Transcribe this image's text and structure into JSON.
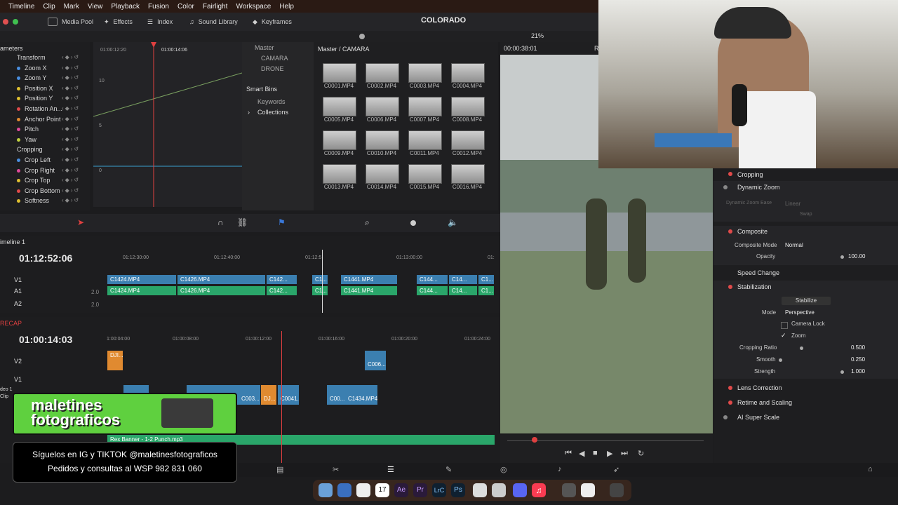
{
  "menu": [
    "Timeline",
    "Clip",
    "Mark",
    "View",
    "Playback",
    "Fusion",
    "Color",
    "Fairlight",
    "Workspace",
    "Help"
  ],
  "toolbar": {
    "media_pool": "Media Pool",
    "effects": "Effects",
    "index": "Index",
    "sound_library": "Sound Library",
    "keyframes": "Keyframes",
    "project": "COLORADO",
    "zoom": "21%",
    "timecode": "00:00:38:01",
    "viewer_tag": "R"
  },
  "params": {
    "header": "ameters",
    "rows": [
      {
        "label": "Transform",
        "group": true
      },
      {
        "label": "Zoom X",
        "color": "#4a8fe0"
      },
      {
        "label": "Zoom Y",
        "color": "#4a8fe0"
      },
      {
        "label": "Position X",
        "color": "#e0c030"
      },
      {
        "label": "Position Y",
        "color": "#e0c030"
      },
      {
        "label": "Rotation An...",
        "color": "#e04a4a"
      },
      {
        "label": "Anchor Point",
        "color": "#e08a30"
      },
      {
        "label": "Pitch",
        "color": "#e04a9a"
      },
      {
        "label": "Yaw",
        "color": "#c0d040"
      },
      {
        "label": "Cropping",
        "group": true
      },
      {
        "label": "Crop Left",
        "color": "#4a8fe0"
      },
      {
        "label": "Crop Right",
        "color": "#e04a9a"
      },
      {
        "label": "Crop Top",
        "color": "#e0c030"
      },
      {
        "label": "Crop Bottom",
        "color": "#e04a4a"
      },
      {
        "label": "Softness",
        "color": "#e0c030"
      }
    ]
  },
  "curve": {
    "t1": "01:00:12:20",
    "t2": "01:00:14:06",
    "y1": "10",
    "y2": "5",
    "y3": "0"
  },
  "bins": {
    "master": "Master",
    "camara": "CAMARA",
    "drone": "DRONE",
    "smart": "Smart Bins",
    "keywords": "Keywords",
    "collections": "Collections"
  },
  "pool": {
    "path": "Master / CAMARA",
    "clips": [
      "C0001.MP4",
      "C0002.MP4",
      "C0003.MP4",
      "C0004.MP4",
      "C0005.MP4",
      "C0006.MP4",
      "C0007.MP4",
      "C0008.MP4",
      "C0009.MP4",
      "C0010.MP4",
      "C0011.MP4",
      "C0012.MP4",
      "C0013.MP4",
      "C0014.MP4",
      "C0015.MP4",
      "C0016.MP4"
    ]
  },
  "inspector": {
    "cropping": "Cropping",
    "dynamic_zoom": "Dynamic Zoom",
    "dz_ease": "Dynamic Zoom Ease",
    "linear": "Linear",
    "swap": "Swap",
    "composite": "Composite",
    "composite_mode_label": "Composite Mode",
    "composite_mode": "Normal",
    "opacity_label": "Opacity",
    "opacity": "100.00",
    "speed": "Speed Change",
    "stabilization": "Stabilization",
    "stabilize": "Stabilize",
    "mode_label": "Mode",
    "mode": "Perspective",
    "camera_lock": "Camera Lock",
    "zoom": "Zoom",
    "crop_ratio_label": "Cropping Ratio",
    "crop_ratio": "0.500",
    "smooth_label": "Smooth",
    "smooth": "0.250",
    "strength_label": "Strength",
    "strength": "1.000",
    "lens": "Lens Correction",
    "retime": "Retime and Scaling",
    "super": "AI Super Scale"
  },
  "timeline1": {
    "name": "imeline 1",
    "timecode": "01:12:52:06",
    "ticks": [
      "01:12:30:00",
      "01:12:40:00",
      "01:12:5",
      "01:13:00:00",
      "01:"
    ],
    "v1": "V1",
    "a1": "A1",
    "a2": "A2",
    "level": "2.0",
    "clips": [
      "C1424.MP4",
      "C1426.MP4",
      "C142...",
      "C1...",
      "C1441.MP4",
      "C144...",
      "C14...",
      "C1..."
    ]
  },
  "timeline2": {
    "name": "RECAP",
    "timecode": "01:00:14:03",
    "ticks": [
      "1:00:04:00",
      "01:00:08:00",
      "01:00:12:00",
      "01:00:16:00",
      "01:00:20:00",
      "01:00:24:00"
    ],
    "v2": "V2",
    "v1": "V1",
    "clips_v2": [
      "DJI...",
      "C006..."
    ],
    "clips_v1": [
      "C003...",
      "DJ...",
      "C0041...",
      "C00...",
      "C1434.MP4"
    ],
    "sub": "Rex Banner - 1-2 Punch.mp3",
    "video_label": "deo 1",
    "clip_label": "Clip"
  },
  "banner": {
    "line1": "maletines",
    "line2": "fotograficos"
  },
  "banner2": {
    "line1": "Síguelos en IG y TIKTOK @maletinesfotograficos",
    "line2": "Pedidos y consultas al WSP 982 831 060"
  },
  "dock_date": "17",
  "dock_apps": [
    "Ae",
    "Pr",
    "LrC",
    "Ps"
  ]
}
